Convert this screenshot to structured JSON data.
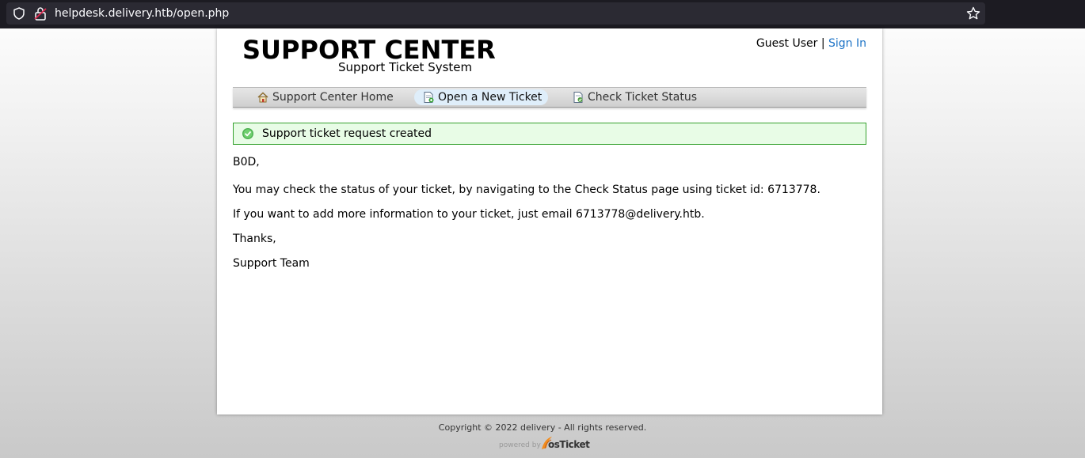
{
  "browser": {
    "url": "helpdesk.delivery.htb/open.php"
  },
  "header": {
    "logo_title": "SUPPORT CENTER",
    "logo_subtitle": "Support Ticket System",
    "user_label": "Guest User",
    "separator": "|",
    "sign_in": "Sign In"
  },
  "nav": {
    "items": [
      {
        "label": "Support Center Home",
        "icon": "home-icon"
      },
      {
        "label": "Open a New Ticket",
        "icon": "new-ticket-icon",
        "active": true
      },
      {
        "label": "Check Ticket Status",
        "icon": "ticket-status-icon"
      }
    ]
  },
  "notice": {
    "text": "Support ticket request created",
    "icon": "check-circle-icon"
  },
  "message": {
    "greeting": "B0D,",
    "status_line": "You may check the status of your ticket, by navigating to the Check Status page using ticket id: 6713778.",
    "email_line": "If you want to add more information to your ticket, just email 6713778@delivery.htb.",
    "thanks": "Thanks,",
    "signature": "Support Team"
  },
  "footer": {
    "copyright": "Copyright © 2022 delivery - All rights reserved.",
    "powered_by": "powered by",
    "brand": "osTicket"
  },
  "colors": {
    "link": "#1b72c6",
    "notice_bg": "#e8fce6",
    "notice_border": "#36a22f",
    "nav_active_bg": "#dfeefa",
    "browser_bar": "#1c1b22"
  }
}
